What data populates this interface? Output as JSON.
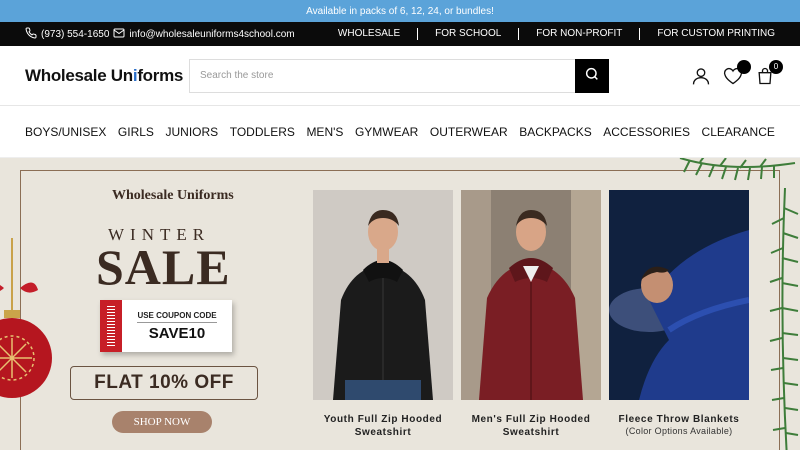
{
  "announcement": "Available in packs of 6, 12, 24, or bundles!",
  "topbar": {
    "phone": "(973) 554-1650",
    "email": "info@wholesaleuniforms4school.com",
    "links": [
      "WHOLESALE",
      "FOR SCHOOL",
      "FOR NON-PROFIT",
      "FOR CUSTOM PRINTING"
    ]
  },
  "header": {
    "logo_pre": "Wholesale Un",
    "logo_i": "i",
    "logo_post": "forms",
    "search_placeholder": "Search the store",
    "cart_count": "0"
  },
  "nav": [
    "BOYS/UNISEX",
    "GIRLS",
    "JUNIORS",
    "TODDLERS",
    "MEN'S",
    "GYMWEAR",
    "OUTERWEAR",
    "BACKPACKS",
    "ACCESSORIES",
    "CLEARANCE"
  ],
  "hero": {
    "brand": "Wholesale Uniforms",
    "season": "WINTER",
    "sale": "SALE",
    "coupon_label": "USE COUPON CODE",
    "coupon_code": "SAVE10",
    "offer": "FLAT 10% OFF",
    "cta": "SHOP NOW",
    "products": [
      {
        "title": "Youth Full Zip Hooded Sweatshirt",
        "sub": "",
        "color": "#1b1b1b"
      },
      {
        "title": "Men's Full Zip Hooded Sweatshirt",
        "sub": "",
        "color": "#7a1e24"
      },
      {
        "title": "Fleece Throw Blankets",
        "sub": "(Color Options Available)",
        "color": "#1f3b8c"
      }
    ]
  },
  "colors": {
    "announce_bg": "#5ba3d9",
    "hero_bg": "#e9e5dc",
    "accent_brown": "#3b2b22",
    "coupon_red": "#c71f27"
  }
}
